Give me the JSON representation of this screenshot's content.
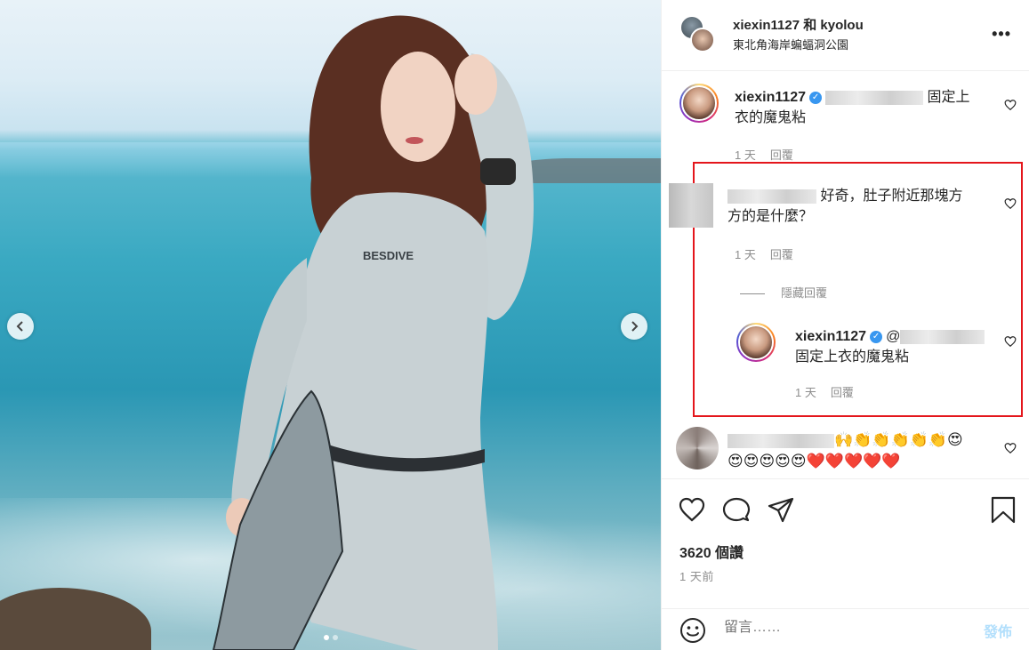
{
  "colors": {
    "accent_blue": "#0095f6",
    "post_disabled": "#b2dffc",
    "highlight_red": "#e4161c",
    "verified": "#3897f0"
  },
  "header": {
    "title": "xiexin1127 和 kyolou",
    "location": "東北角海岸蝙蝠洞公園",
    "more_icon": "more-horizontal-icon",
    "more_label": "•••"
  },
  "photo": {
    "prev_icon": "chevron-left-icon",
    "next_icon": "chevron-right-icon",
    "suit_brand": "BESDIVE",
    "page_count": 2,
    "active_page": 1
  },
  "comments": [
    {
      "username": "xiexin1127",
      "verified": true,
      "text_line1": "固定上",
      "text_line2": "衣的魔鬼粘",
      "time": "1 天",
      "reply": "回覆"
    },
    {
      "username": "",
      "text_line1": "好奇，肚子附近那塊方",
      "text_line2": "方的是什麼？",
      "time": "1 天",
      "reply": "回覆",
      "hide_replies": "隱藏回覆",
      "replies": [
        {
          "username": "xiexin1127",
          "verified": true,
          "mention": "@",
          "text": "固定上衣的魔鬼粘",
          "time": "1 天",
          "reply": "回覆"
        }
      ]
    },
    {
      "username": "",
      "emoji_line1": "🙌👏👏👏👏👏😍",
      "emoji_line2": "😍😍😍😍😍❤️❤️❤️❤️❤️"
    }
  ],
  "actions": {
    "like_icon": "heart-icon",
    "comment_icon": "comment-icon",
    "share_icon": "send-icon",
    "save_icon": "bookmark-icon"
  },
  "likes": "3620 個讚",
  "time_ago": "1 天前",
  "comment_box": {
    "placeholder": "留言……",
    "post_label": "發佈",
    "emoji_icon": "smile-icon"
  }
}
